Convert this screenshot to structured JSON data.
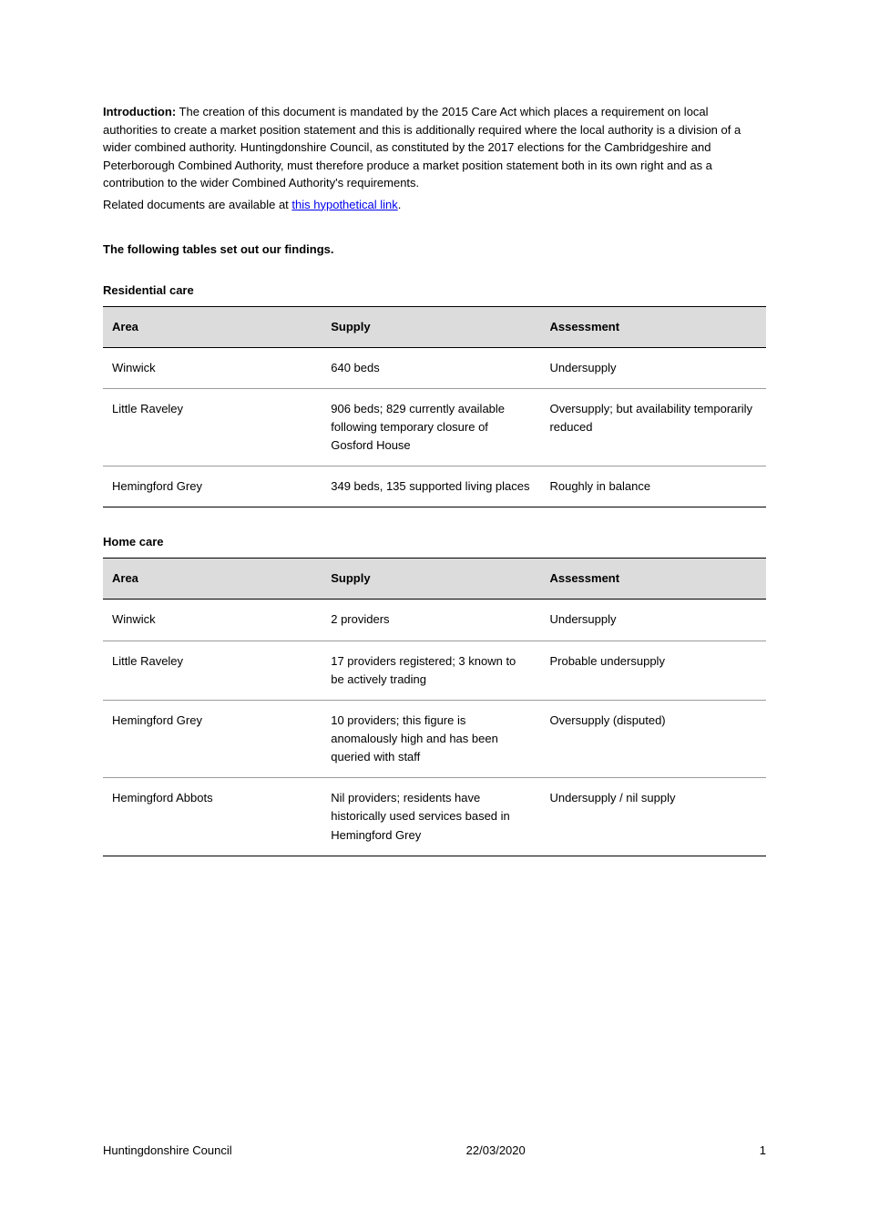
{
  "header": {
    "intro_title": "Introduction:",
    "intro_text": "The creation of this document is mandated by the 2015 Care Act which places a requirement on local authorities to create a market position statement and this is additionally required where the local authority is a division of a wider combined authority. Huntingdonshire Council, as constituted by the 2017 elections for the Cambridgeshire and Peterborough Combined Authority, must therefore produce a market position statement both in its own right and as a contribution to the wider Combined Authority's requirements.",
    "related_prefix": "Related documents are available at ",
    "related_link_text": "this hypothetical link",
    "related_suffix": "."
  },
  "subheadings": {
    "summary_caption": "The following tables set out our findings.",
    "residential": "Residential care",
    "home_care": "Home care"
  },
  "tables": {
    "header": [
      "Area",
      "Supply",
      "Assessment"
    ],
    "residential": [
      [
        "Winwick",
        "640 beds",
        "Undersupply"
      ],
      [
        "Little Raveley",
        "906 beds; 829 currently available following temporary closure of Gosford House",
        "Oversupply; but availability temporarily reduced"
      ],
      [
        "Hemingford Grey",
        "349 beds, 135 supported living places",
        "Roughly in balance"
      ]
    ],
    "home_care": [
      [
        "Winwick",
        "2 providers",
        "Undersupply"
      ],
      [
        "Little Raveley",
        "17 providers registered; 3 known to be actively trading",
        "Probable undersupply"
      ],
      [
        "Hemingford Grey",
        "10 providers; this figure is anomalously high and has been queried with staff",
        "Oversupply (disputed)"
      ],
      [
        "Hemingford Abbots",
        "Nil providers; residents have historically used services based in Hemingford Grey",
        "Undersupply / nil supply"
      ]
    ]
  },
  "footer": {
    "left": "Huntingdonshire Council",
    "center": "22/03/2020",
    "right": "1"
  }
}
